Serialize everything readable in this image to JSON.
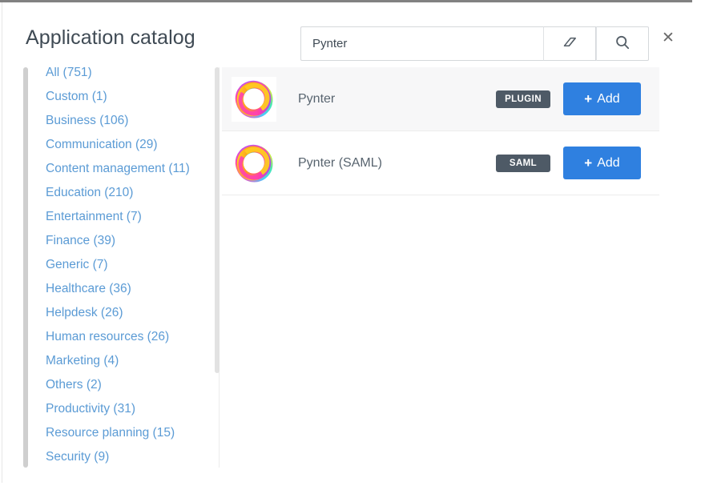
{
  "header": {
    "title": "Application catalog",
    "close_label": "✕",
    "close_icon": "close-icon"
  },
  "search": {
    "value": "Pynter",
    "placeholder": "Search",
    "clear_icon": "eraser-icon",
    "submit_icon": "search-icon"
  },
  "sidebar": {
    "items": [
      {
        "label": "All (751)"
      },
      {
        "label": "Custom (1)"
      },
      {
        "label": "Business (106)"
      },
      {
        "label": "Communication (29)"
      },
      {
        "label": "Content management (11)"
      },
      {
        "label": "Education (210)"
      },
      {
        "label": "Entertainment (7)"
      },
      {
        "label": "Finance (39)"
      },
      {
        "label": "Generic (7)"
      },
      {
        "label": "Healthcare (36)"
      },
      {
        "label": "Helpdesk (26)"
      },
      {
        "label": "Human resources (26)"
      },
      {
        "label": "Marketing (4)"
      },
      {
        "label": "Others (2)"
      },
      {
        "label": "Productivity (31)"
      },
      {
        "label": "Resource planning (15)"
      },
      {
        "label": "Security (9)"
      }
    ]
  },
  "results": {
    "rows": [
      {
        "name": "Pynter",
        "badge": "PLUGIN",
        "add_label": "Add",
        "logo_icon": "pynter-ring-logo-icon",
        "selected": true
      },
      {
        "name": "Pynter (SAML)",
        "badge": "SAML",
        "add_label": "Add",
        "logo_icon": "pynter-ring-logo-icon",
        "selected": false
      }
    ]
  },
  "colors": {
    "accent_blue": "#2f80e0",
    "link_blue": "#5b9bd5",
    "badge_gray": "#4e5a66",
    "title_gray": "#3f4a54",
    "row_selected": "#f7f7f8"
  }
}
